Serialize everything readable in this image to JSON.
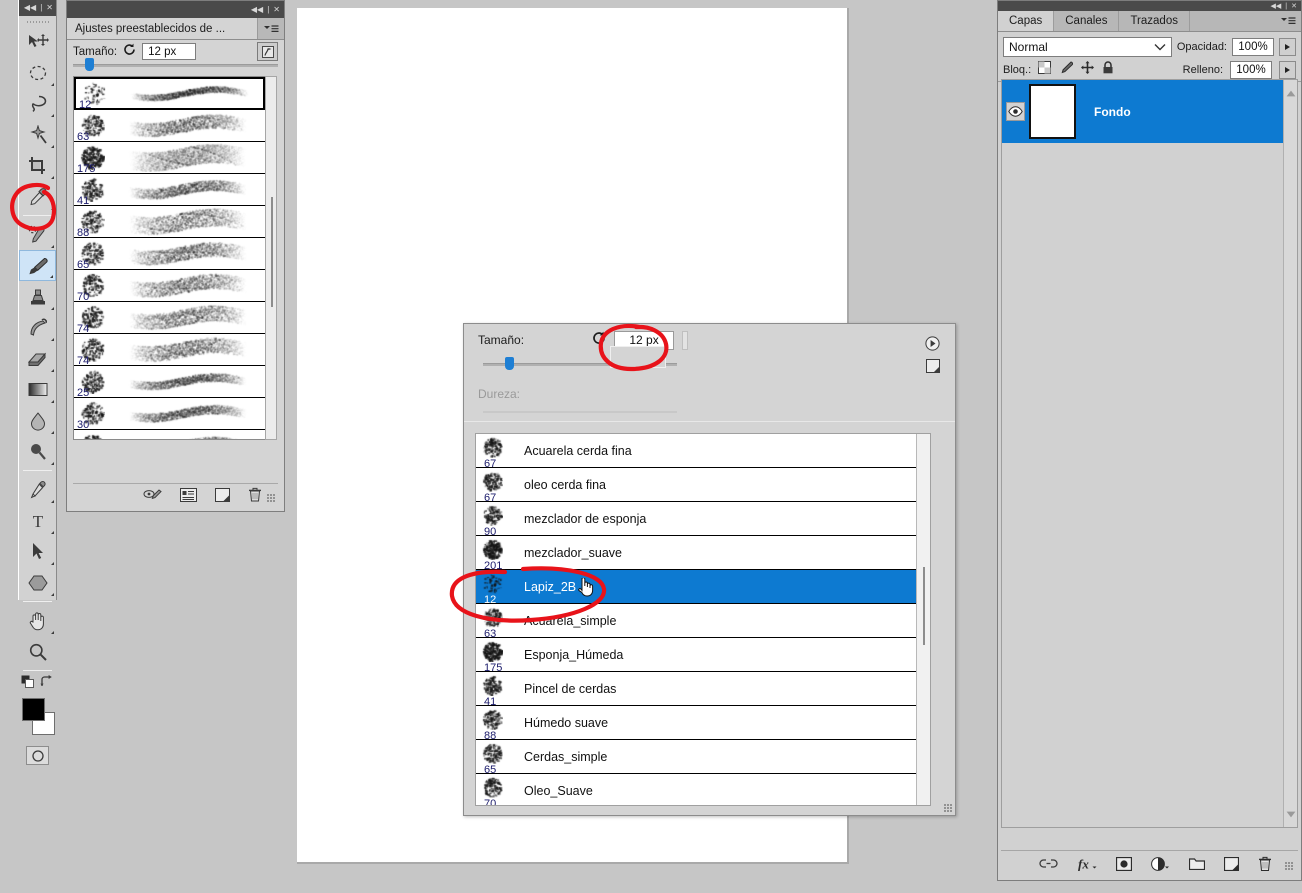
{
  "app": {
    "accent_blue": "#0d7ad1",
    "annotation_color": "#e8131a"
  },
  "toolbar": {
    "collapse_label": "◀◀",
    "close_label": "✕",
    "tools": [
      {
        "name": "move-tool",
        "label": "Mover"
      },
      {
        "name": "marquee-tool",
        "label": "Marco rectangular"
      },
      {
        "name": "lasso-tool",
        "label": "Lazo"
      },
      {
        "name": "magic-wand-tool",
        "label": "Varita mágica"
      },
      {
        "name": "crop-tool",
        "label": "Recortar"
      },
      {
        "name": "eyedropper-tool",
        "label": "Cuentagotas"
      },
      {
        "name": "healing-brush-tool",
        "label": "Pincel corrector"
      },
      {
        "name": "brush-tool",
        "label": "Pincel",
        "selected": true
      },
      {
        "name": "clone-stamp-tool",
        "label": "Tampón de clonar"
      },
      {
        "name": "history-brush-tool",
        "label": "Pincel de historia"
      },
      {
        "name": "eraser-tool",
        "label": "Borrador"
      },
      {
        "name": "gradient-tool",
        "label": "Degradado"
      },
      {
        "name": "blur-tool",
        "label": "Desenfocar"
      },
      {
        "name": "dodge-tool",
        "label": "Sobreexponer"
      },
      {
        "name": "pen-tool",
        "label": "Pluma"
      },
      {
        "name": "type-tool",
        "label": "Texto"
      },
      {
        "name": "path-selection-tool",
        "label": "Selección de trazado"
      },
      {
        "name": "shape-tool",
        "label": "Forma"
      },
      {
        "name": "hand-tool",
        "label": "Mano"
      },
      {
        "name": "zoom-tool",
        "label": "Zoom"
      }
    ],
    "foreground_color": "#000000",
    "background_color": "#ffffff",
    "quickmask_label": "Modo máscara rápida"
  },
  "presets_panel": {
    "collapse_label": "◀◀",
    "close_label": "✕",
    "tab_label": "Ajustes preestablecidos de ...",
    "menu_label": "≡",
    "size_label": "Tamaño:",
    "size_value": "12 px",
    "brushes": [
      {
        "size": "12"
      },
      {
        "size": "63"
      },
      {
        "size": "175"
      },
      {
        "size": "41"
      },
      {
        "size": "88"
      },
      {
        "size": "65"
      },
      {
        "size": "70"
      },
      {
        "size": "74"
      },
      {
        "size": "74"
      },
      {
        "size": "25"
      },
      {
        "size": "30"
      },
      {
        "size": ""
      }
    ],
    "footer_icons": [
      "brush-preview-icon",
      "list-view-icon",
      "new-brush-icon",
      "delete-brush-icon"
    ]
  },
  "brush_dialog": {
    "size_label": "Tamaño:",
    "size_value": "12 px",
    "hardness_label": "Dureza:",
    "hardness_value": "",
    "gear_icon": "panel-menu-icon",
    "new_brush_icon": "new-brush-icon",
    "brushes": [
      {
        "name": "Acuarela cerda fina",
        "size": "67",
        "selected": false
      },
      {
        "name": "oleo cerda fina",
        "size": "67",
        "selected": false
      },
      {
        "name": "mezclador de esponja",
        "size": "90",
        "selected": false
      },
      {
        "name": "mezclador_suave",
        "size": "201",
        "selected": false
      },
      {
        "name": "Lapiz_2B",
        "size": "12",
        "selected": true
      },
      {
        "name": "Acuarela_simple",
        "size": "63",
        "selected": false
      },
      {
        "name": "Esponja_Húmeda",
        "size": "175",
        "selected": false
      },
      {
        "name": "Pincel de cerdas",
        "size": "41",
        "selected": false
      },
      {
        "name": "Húmedo suave",
        "size": "88",
        "selected": false
      },
      {
        "name": "Cerdas_simple",
        "size": "65",
        "selected": false
      },
      {
        "name": "Oleo_Suave",
        "size": "70",
        "selected": false
      }
    ]
  },
  "layers_panel": {
    "collapse_label": "◀◀",
    "close_label": "✕",
    "tabs": [
      {
        "label": "Capas",
        "active": true
      },
      {
        "label": "Canales",
        "active": false
      },
      {
        "label": "Trazados",
        "active": false
      }
    ],
    "menu_label": "≡",
    "blend_mode": "Normal",
    "opacity_label": "Opacidad:",
    "opacity_value": "100%",
    "lock_label": "Bloq.:",
    "fill_label": "Relleno:",
    "fill_value": "100%",
    "lock_icons": [
      "lock-transparent-pixels-icon",
      "lock-image-pixels-icon",
      "lock-position-icon",
      "lock-all-icon"
    ],
    "layers": [
      {
        "name": "Fondo",
        "visible": true,
        "selected": true
      }
    ],
    "footer_icons": [
      "link-layers-icon",
      "layer-style-icon",
      "layer-mask-icon",
      "adjustment-layer-icon",
      "new-group-icon",
      "new-layer-icon",
      "delete-layer-icon"
    ]
  }
}
